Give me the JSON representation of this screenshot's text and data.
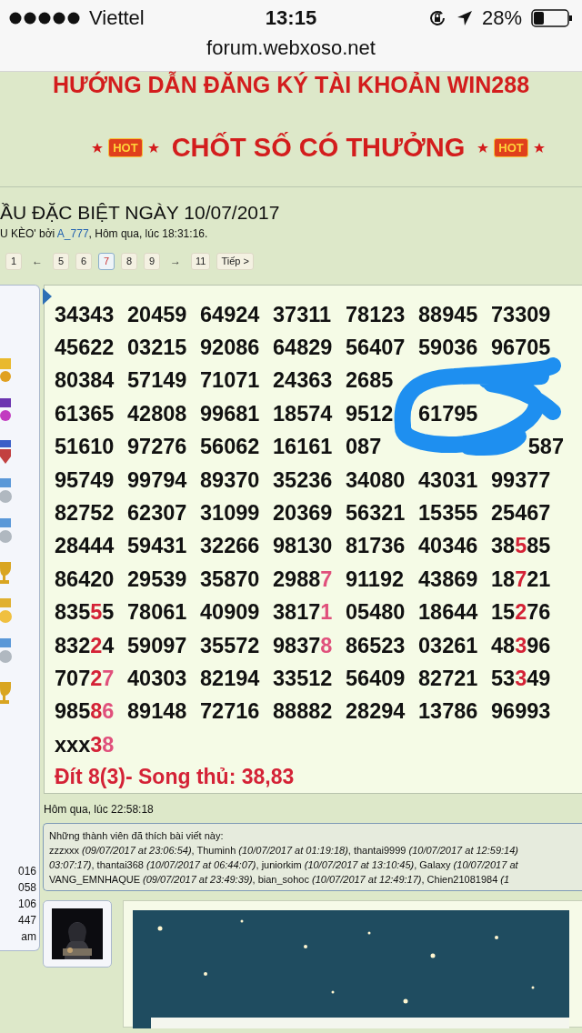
{
  "status_bar": {
    "carrier": "Viettel",
    "time": "13:15",
    "battery": "28%"
  },
  "address_bar": {
    "url": "forum.webxoso.net"
  },
  "banner": {
    "headline": "HƯỚNG DẪN ĐĂNG KÝ TÀI KHOẢN WIN288",
    "hot_badges": [
      "HOT",
      "HOT"
    ],
    "slogan": "CHỐT SỐ CÓ THƯỞNG"
  },
  "thread": {
    "title": "ẦU ĐẶC BIỆT NGÀY 10/07/2017",
    "meta_before": "U KÈO' bởi ",
    "author": "A_777",
    "meta_after": ", Hôm qua, lúc 18:31:16."
  },
  "pagination": [
    {
      "kind": "page",
      "label": "1",
      "selected": false
    },
    {
      "kind": "arrow",
      "label": "←"
    },
    {
      "kind": "page",
      "label": "5",
      "selected": false
    },
    {
      "kind": "page",
      "label": "6",
      "selected": false
    },
    {
      "kind": "page",
      "label": "7",
      "selected": true
    },
    {
      "kind": "page",
      "label": "8",
      "selected": false
    },
    {
      "kind": "page",
      "label": "9",
      "selected": false
    },
    {
      "kind": "arrow",
      "label": "→"
    },
    {
      "kind": "page",
      "label": "11",
      "selected": false
    },
    {
      "kind": "page",
      "label": "Tiếp >",
      "selected": false
    }
  ],
  "sidebar": {
    "stats": [
      "016",
      "058",
      "106",
      "447",
      "am"
    ]
  },
  "post": {
    "rows": [
      [
        {
          "kind": "number",
          "parts": [
            {
              "text": "34343"
            }
          ]
        },
        {
          "kind": "number",
          "parts": [
            {
              "text": "20459"
            }
          ]
        },
        {
          "kind": "number",
          "parts": [
            {
              "text": "64924"
            }
          ]
        },
        {
          "kind": "number",
          "parts": [
            {
              "text": "37311"
            }
          ]
        },
        {
          "kind": "number",
          "parts": [
            {
              "text": "78123"
            }
          ]
        },
        {
          "kind": "number",
          "parts": [
            {
              "text": "88945"
            }
          ]
        },
        {
          "kind": "number",
          "parts": [
            {
              "text": "73309"
            }
          ]
        }
      ],
      [
        {
          "kind": "number",
          "parts": [
            {
              "text": "45622"
            }
          ]
        },
        {
          "kind": "number",
          "parts": [
            {
              "text": "03215"
            }
          ]
        },
        {
          "kind": "number",
          "parts": [
            {
              "text": "92086"
            }
          ]
        },
        {
          "kind": "number",
          "parts": [
            {
              "text": "64829"
            }
          ]
        },
        {
          "kind": "number",
          "parts": [
            {
              "text": "56407"
            }
          ]
        },
        {
          "kind": "number",
          "parts": [
            {
              "text": "59036"
            }
          ]
        },
        {
          "kind": "number",
          "parts": [
            {
              "text": "96705"
            }
          ]
        }
      ],
      [
        {
          "kind": "number",
          "parts": [
            {
              "text": "80384"
            }
          ]
        },
        {
          "kind": "number",
          "parts": [
            {
              "text": "57149"
            }
          ]
        },
        {
          "kind": "number",
          "parts": [
            {
              "text": "71071"
            }
          ]
        },
        {
          "kind": "number",
          "parts": [
            {
              "text": "24363"
            }
          ]
        },
        {
          "kind": "number",
          "parts": [
            {
              "text": "2685"
            }
          ]
        },
        {
          "kind": "covered"
        },
        {
          "kind": "covered"
        }
      ],
      [
        {
          "kind": "number",
          "parts": [
            {
              "text": "61365"
            }
          ]
        },
        {
          "kind": "number",
          "parts": [
            {
              "text": "42808"
            }
          ]
        },
        {
          "kind": "number",
          "parts": [
            {
              "text": "99681"
            }
          ]
        },
        {
          "kind": "number",
          "parts": [
            {
              "text": "18574"
            }
          ]
        },
        {
          "kind": "number",
          "parts": [
            {
              "text": "9512"
            }
          ]
        },
        {
          "kind": "number",
          "parts": [
            {
              "text": "61795"
            }
          ]
        },
        {
          "kind": "covered"
        }
      ],
      [
        {
          "kind": "number",
          "parts": [
            {
              "text": "51610"
            }
          ]
        },
        {
          "kind": "number",
          "parts": [
            {
              "text": "97276"
            }
          ]
        },
        {
          "kind": "number",
          "parts": [
            {
              "text": "56062"
            }
          ]
        },
        {
          "kind": "number",
          "parts": [
            {
              "text": "16161"
            }
          ]
        },
        {
          "kind": "number",
          "parts": [
            {
              "text": "087"
            }
          ]
        },
        {
          "kind": "covered"
        },
        {
          "kind": "tail",
          "parts": [
            {
              "text": "587"
            }
          ]
        }
      ],
      [
        {
          "kind": "number",
          "parts": [
            {
              "text": "95749"
            }
          ]
        },
        {
          "kind": "number",
          "parts": [
            {
              "text": "99794"
            }
          ]
        },
        {
          "kind": "number",
          "parts": [
            {
              "text": "89370"
            }
          ]
        },
        {
          "kind": "number",
          "parts": [
            {
              "text": "35236"
            }
          ]
        },
        {
          "kind": "number",
          "parts": [
            {
              "text": "34080"
            }
          ]
        },
        {
          "kind": "number",
          "parts": [
            {
              "text": "43031"
            }
          ]
        },
        {
          "kind": "number",
          "parts": [
            {
              "text": "99377"
            }
          ]
        }
      ],
      [
        {
          "kind": "number",
          "parts": [
            {
              "text": "82752"
            }
          ]
        },
        {
          "kind": "number",
          "parts": [
            {
              "text": "62307"
            }
          ]
        },
        {
          "kind": "number",
          "parts": [
            {
              "text": "31099"
            }
          ]
        },
        {
          "kind": "number",
          "parts": [
            {
              "text": "20369"
            }
          ]
        },
        {
          "kind": "number",
          "parts": [
            {
              "text": "56321"
            }
          ]
        },
        {
          "kind": "number",
          "parts": [
            {
              "text": "15355"
            }
          ]
        },
        {
          "kind": "number",
          "parts": [
            {
              "text": "25467"
            }
          ]
        }
      ],
      [
        {
          "kind": "number",
          "parts": [
            {
              "text": "28444"
            }
          ]
        },
        {
          "kind": "number",
          "parts": [
            {
              "text": "59431"
            }
          ]
        },
        {
          "kind": "number",
          "parts": [
            {
              "text": "32266"
            }
          ]
        },
        {
          "kind": "number",
          "parts": [
            {
              "text": "98130"
            }
          ]
        },
        {
          "kind": "number",
          "parts": [
            {
              "text": "81736"
            }
          ]
        },
        {
          "kind": "number",
          "parts": [
            {
              "text": "40346"
            }
          ]
        },
        {
          "kind": "number",
          "parts": [
            {
              "text": "38"
            },
            {
              "text": "5",
              "color": "#d42236"
            },
            {
              "text": "85"
            }
          ]
        }
      ],
      [
        {
          "kind": "number",
          "parts": [
            {
              "text": "86420"
            }
          ]
        },
        {
          "kind": "number",
          "parts": [
            {
              "text": "29539"
            }
          ]
        },
        {
          "kind": "number",
          "parts": [
            {
              "text": "35870"
            }
          ]
        },
        {
          "kind": "number",
          "parts": [
            {
              "text": "2988"
            },
            {
              "text": "7",
              "color": "#e0507c"
            }
          ]
        },
        {
          "kind": "number",
          "parts": [
            {
              "text": "91192"
            }
          ]
        },
        {
          "kind": "number",
          "parts": [
            {
              "text": "43869"
            }
          ]
        },
        {
          "kind": "number",
          "parts": [
            {
              "text": "18"
            },
            {
              "text": "7",
              "color": "#d42236"
            },
            {
              "text": "21"
            }
          ]
        }
      ],
      [
        {
          "kind": "number",
          "parts": [
            {
              "text": "835"
            },
            {
              "text": "5",
              "color": "#d42236"
            },
            {
              "text": "5"
            }
          ]
        },
        {
          "kind": "number",
          "parts": [
            {
              "text": "78061"
            }
          ]
        },
        {
          "kind": "number",
          "parts": [
            {
              "text": "40909"
            }
          ]
        },
        {
          "kind": "number",
          "parts": [
            {
              "text": "3817"
            },
            {
              "text": "1",
              "color": "#e0507c"
            }
          ]
        },
        {
          "kind": "number",
          "parts": [
            {
              "text": "05480"
            }
          ]
        },
        {
          "kind": "number",
          "parts": [
            {
              "text": "18644"
            }
          ]
        },
        {
          "kind": "number",
          "parts": [
            {
              "text": "15"
            },
            {
              "text": "2",
              "color": "#d42236"
            },
            {
              "text": "76"
            }
          ]
        }
      ],
      [
        {
          "kind": "number",
          "parts": [
            {
              "text": "832"
            },
            {
              "text": "2",
              "color": "#d42236"
            },
            {
              "text": "4"
            }
          ]
        },
        {
          "kind": "number",
          "parts": [
            {
              "text": "59097"
            }
          ]
        },
        {
          "kind": "number",
          "parts": [
            {
              "text": "35572"
            }
          ]
        },
        {
          "kind": "number",
          "parts": [
            {
              "text": "9837"
            },
            {
              "text": "8",
              "color": "#e0507c"
            }
          ]
        },
        {
          "kind": "number",
          "parts": [
            {
              "text": "86523"
            }
          ]
        },
        {
          "kind": "number",
          "parts": [
            {
              "text": "03261"
            }
          ]
        },
        {
          "kind": "number",
          "parts": [
            {
              "text": "48"
            },
            {
              "text": "3",
              "color": "#d42236"
            },
            {
              "text": "96"
            }
          ]
        }
      ],
      [
        {
          "kind": "number",
          "parts": [
            {
              "text": "707"
            },
            {
              "text": "2",
              "color": "#d42236"
            },
            {
              "text": "7",
              "color": "#e0507c"
            }
          ]
        },
        {
          "kind": "number",
          "parts": [
            {
              "text": "40303"
            }
          ]
        },
        {
          "kind": "number",
          "parts": [
            {
              "text": "82194"
            }
          ]
        },
        {
          "kind": "number",
          "parts": [
            {
              "text": "33512"
            }
          ]
        },
        {
          "kind": "number",
          "parts": [
            {
              "text": "56409"
            }
          ]
        },
        {
          "kind": "number",
          "parts": [
            {
              "text": "82721"
            }
          ]
        },
        {
          "kind": "number",
          "parts": [
            {
              "text": "53"
            },
            {
              "text": "3",
              "color": "#d42236"
            },
            {
              "text": "49"
            }
          ]
        }
      ],
      [
        {
          "kind": "number",
          "parts": [
            {
              "text": "985"
            },
            {
              "text": "8",
              "color": "#d42236"
            },
            {
              "text": "6",
              "color": "#e0507c"
            }
          ]
        },
        {
          "kind": "number",
          "parts": [
            {
              "text": "89148"
            }
          ]
        },
        {
          "kind": "number",
          "parts": [
            {
              "text": "72716"
            }
          ]
        },
        {
          "kind": "number",
          "parts": [
            {
              "text": "88882"
            }
          ]
        },
        {
          "kind": "number",
          "parts": [
            {
              "text": "28294"
            }
          ]
        },
        {
          "kind": "number",
          "parts": [
            {
              "text": "13786"
            }
          ]
        },
        {
          "kind": "number",
          "parts": [
            {
              "text": "96993"
            }
          ]
        }
      ],
      [
        {
          "kind": "number",
          "parts": [
            {
              "text": "xxx"
            },
            {
              "text": "3",
              "color": "#d42236"
            },
            {
              "text": "8",
              "color": "#e0507c"
            }
          ]
        }
      ]
    ],
    "overlay": {
      "kind": "scribble"
    },
    "summary": "Đít 8(3)- Song thủ: 38,83",
    "time": "Hôm qua, lúc 22:58:18"
  },
  "likes": {
    "heading": "Những thành viên đã thích bài viết này:",
    "lines": [
      "zzzxxx *(09/07/2017 at 23:06:54)*, Thuminh *(10/07/2017 at 01:19:18)*, thantai9999 *(10/07/2017 at 12:59:14)*",
      "*03:07:17)*, thantai368 *(10/07/2017 at 06:44:07)*, juniorkim *(10/07/2017 at 13:10:45)*, Galaxy *(10/07/2017 at*",
      "VANG_EMNHAQUE *(09/07/2017 at 23:49:39)*, bian_sohoc *(10/07/2017 at 12:49:17)*, Chien21081984 *(1*"
    ]
  }
}
